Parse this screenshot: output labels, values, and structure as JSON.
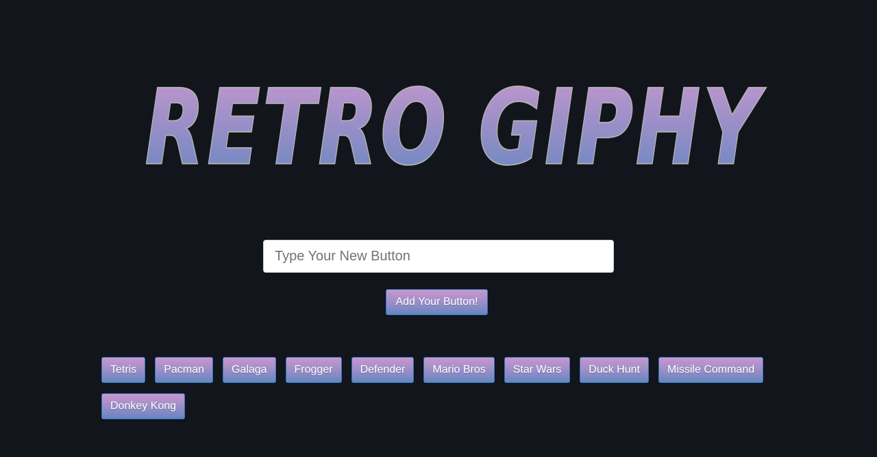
{
  "header": {
    "title": "RETRO GIPHY"
  },
  "form": {
    "input_placeholder": "Type Your New Button",
    "input_value": "",
    "submit_label": "Add Your Button!"
  },
  "buttons": [
    {
      "label": "Tetris"
    },
    {
      "label": "Pacman"
    },
    {
      "label": "Galaga"
    },
    {
      "label": "Frogger"
    },
    {
      "label": "Defender"
    },
    {
      "label": "Mario Bros"
    },
    {
      "label": "Star Wars"
    },
    {
      "label": "Duck Hunt"
    },
    {
      "label": "Missile Command"
    },
    {
      "label": "Donkey Kong"
    }
  ],
  "colors": {
    "background": "#12161c",
    "gradient_top": "#c997ce",
    "gradient_bottom": "#6486c0",
    "title_outline": "#b4b4b4",
    "button_border": "#2b79c2"
  }
}
